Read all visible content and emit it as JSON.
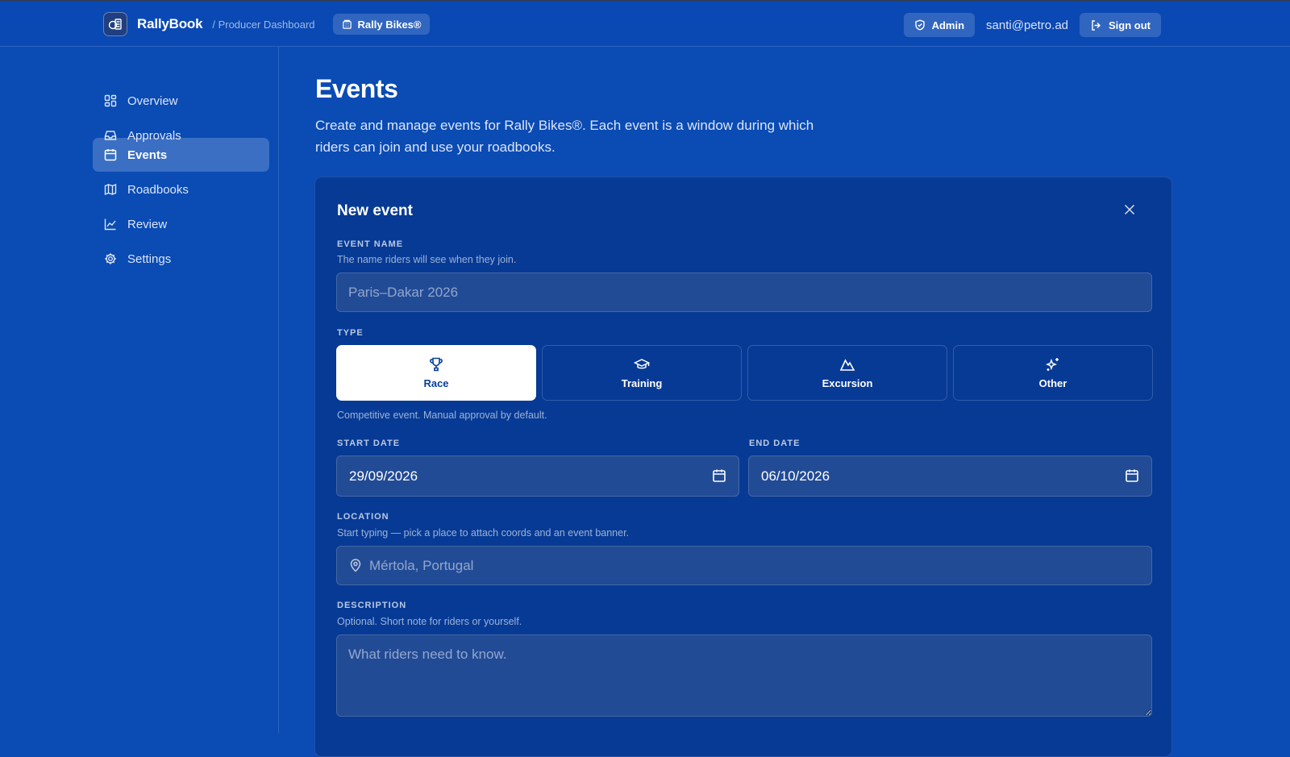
{
  "topbar": {
    "app_name": "RallyBook",
    "breadcrumb": "/ Producer Dashboard",
    "org_name": "Rally Bikes®",
    "admin_label": "Admin",
    "user_email": "santi@petro.ad",
    "sign_out_label": "Sign out"
  },
  "sidebar": {
    "items": [
      {
        "label": "Overview",
        "icon": "grid-icon",
        "active": false
      },
      {
        "label": "Approvals",
        "icon": "inbox-icon",
        "active": false
      },
      {
        "label": "Events",
        "icon": "calendar-icon",
        "active": true
      },
      {
        "label": "Roadbooks",
        "icon": "map-icon",
        "active": false
      },
      {
        "label": "Review",
        "icon": "chart-line-icon",
        "active": false
      },
      {
        "label": "Settings",
        "icon": "gear-icon",
        "active": false
      }
    ]
  },
  "main": {
    "title": "Events",
    "description": "Create and manage events for Rally Bikes®. Each event is a window during which riders can join and use your roadbooks."
  },
  "form": {
    "title": "New event",
    "event_name": {
      "label": "EVENT NAME",
      "hint": "The name riders will see when they join.",
      "value": "",
      "placeholder": "Paris–Dakar 2026"
    },
    "type": {
      "label": "TYPE",
      "options": [
        {
          "label": "Race",
          "icon": "trophy-icon",
          "selected": true
        },
        {
          "label": "Training",
          "icon": "graduation-cap-icon",
          "selected": false
        },
        {
          "label": "Excursion",
          "icon": "mountain-icon",
          "selected": false
        },
        {
          "label": "Other",
          "icon": "sparkles-icon",
          "selected": false
        }
      ],
      "hint": "Competitive event. Manual approval by default."
    },
    "start_date": {
      "label": "START DATE",
      "value": "29/09/2026"
    },
    "end_date": {
      "label": "END DATE",
      "value": "06/10/2026"
    },
    "location": {
      "label": "LOCATION",
      "hint": "Start typing — pick a place to attach coords and an event banner.",
      "value": "",
      "placeholder": "Mértola, Portugal"
    },
    "description": {
      "label": "DESCRIPTION",
      "hint": "Optional. Short note for riders or yourself.",
      "value": "",
      "placeholder": "What riders need to know."
    }
  },
  "colors": {
    "background": "#0a4bb4",
    "card": "#063a95",
    "field": "#224b96",
    "selected_option": "#ffffff",
    "selected_text": "#0a3f9f"
  }
}
